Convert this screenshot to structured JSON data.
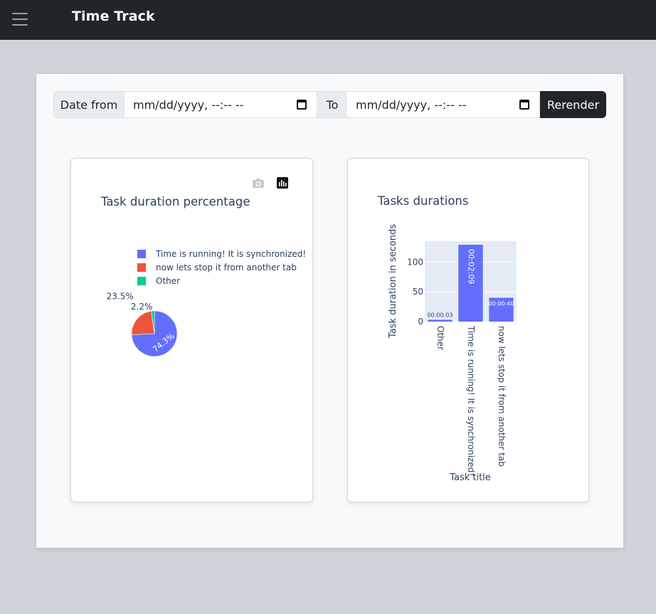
{
  "app": {
    "title": "Time Track"
  },
  "filters": {
    "date_from_label": "Date from",
    "date_from_value": "mm/dd/yyyy, --:-- --",
    "to_label": "To",
    "date_to_value": "mm/dd/yyyy, --:-- --",
    "rerender_label": "Rerender"
  },
  "colors": {
    "navbar": "#212529",
    "series_blue": "#636efa",
    "series_red": "#ef553b",
    "series_green": "#00cc96",
    "plot_bg": "#e5ecf6",
    "text": "#2a3f5f"
  },
  "icons": {
    "menu": "hamburger-icon",
    "camera": "camera-icon",
    "plotly": "plotly-logo-icon",
    "calendar": "calendar-icon"
  },
  "pie_chart": {
    "title": "Task duration percentage",
    "chart_data": {
      "type": "pie",
      "labels": [
        "Time is running! It is synchronized!",
        "now lets stop it from another tab",
        "Other"
      ],
      "values": [
        74.3,
        23.5,
        2.2
      ],
      "text_labels": [
        "74.3%",
        "23.5%",
        "2.2%"
      ],
      "colors": [
        "#636efa",
        "#ef553b",
        "#00cc96"
      ],
      "legend_position": "top"
    }
  },
  "bar_chart": {
    "title": "Tasks durations",
    "chart_data": {
      "type": "bar",
      "categories": [
        "Other",
        "Time is running! It is synchronized!",
        "now lets stop it from another tab"
      ],
      "values": [
        3,
        129,
        40
      ],
      "text_labels": [
        "00:00:03",
        "00:02:09",
        "00:00:40"
      ],
      "xlabel": "Task title",
      "ylabel": "Task duration in seconds",
      "ylim": [
        0,
        135
      ],
      "yticks": [
        0,
        50,
        100
      ],
      "ytick_labels": [
        "0",
        "50",
        "100"
      ],
      "grid": true
    }
  }
}
